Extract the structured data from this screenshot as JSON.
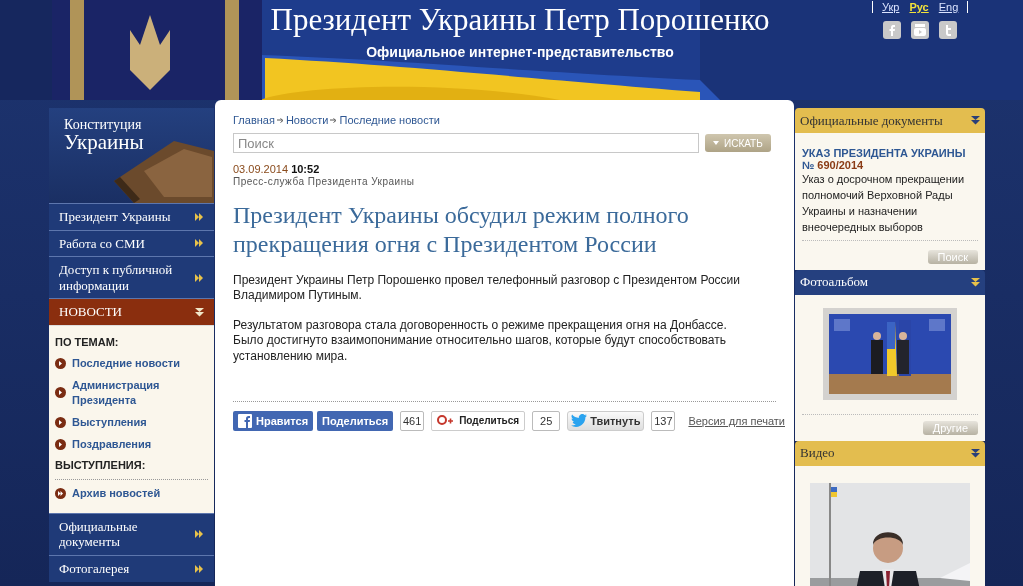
{
  "header": {
    "title": "Президент Украины Петр Порошенко",
    "subtitle": "Официальное интернет-представительство",
    "languages": [
      {
        "label": "Укр",
        "selected": false
      },
      {
        "label": "Рус",
        "selected": true
      },
      {
        "label": "Eng",
        "selected": false
      }
    ]
  },
  "sidebar": {
    "banner": {
      "line1": "Конституция",
      "line2": "Украины"
    },
    "nav": [
      {
        "label": "Президент Украины",
        "selected": false,
        "expanded": false
      },
      {
        "label": "Работа со СМИ",
        "selected": false,
        "expanded": false
      },
      {
        "label": "Доступ к публичной информации",
        "selected": false,
        "expanded": false
      },
      {
        "label": "НОВОСТИ",
        "selected": true,
        "expanded": true,
        "submenu": {
          "groups": [
            {
              "heading": "ПО ТЕМАМ:",
              "items": [
                "Последние новости",
                "Администрация Президента",
                "Выступления",
                "Поздравления"
              ]
            },
            {
              "heading": "ВЫСТУПЛЕНИЯ:"
            }
          ],
          "footer_links": [
            "Архив новостей"
          ]
        }
      },
      {
        "label": "Официальные документы",
        "selected": false,
        "expanded": false
      },
      {
        "label": "Фотогалерея",
        "selected": false,
        "expanded": false
      }
    ]
  },
  "article": {
    "breadcrumb": [
      "Главная",
      "Новости",
      "Последние новости"
    ],
    "search": {
      "placeholder": "Поиск",
      "button": "ИСКАТЬ"
    },
    "date": "03.09.2014",
    "time": "10:52",
    "source": "Пресс-служба Президента Украины",
    "headline": "Президент Украины обсудил режим полного прекращения огня с Президентом России",
    "paragraphs": [
      "Президент Украины Петр Порошенко провел телефонный разговор с Президентом России Владимиром Путиным.",
      "Результатом разговора стала договоренность о режиме прекращения огня на Донбассе. Было достигнуто взаимопонимание относительно шагов, которые будут способствовать установлению мира."
    ],
    "share": {
      "like": "Нравится",
      "fb_share": "Поделиться",
      "fb_count": "461",
      "gplus_share": "Поделиться",
      "gplus_count": "25",
      "tweet": "Твитнуть",
      "tweet_count": "137",
      "print": "Версия для печати"
    }
  },
  "right_panels": [
    {
      "kind": "documents",
      "title": "Официальные документы",
      "color": "#e3bd4f",
      "heading": "УКАЗ ПРЕЗИДЕНТА УКРАИНЫ",
      "number_sign": "№",
      "number": "690/2014",
      "text": "Указ о досрочном прекращении полномочий Верховной Рады Украины и назначении внеочередных выборов",
      "button": "Поиск"
    },
    {
      "title": "Фотоальбом",
      "color": "#25407f",
      "button": "Другие"
    },
    {
      "kind": "video",
      "title": "Видео",
      "color": "#e3bd4f"
    }
  ]
}
